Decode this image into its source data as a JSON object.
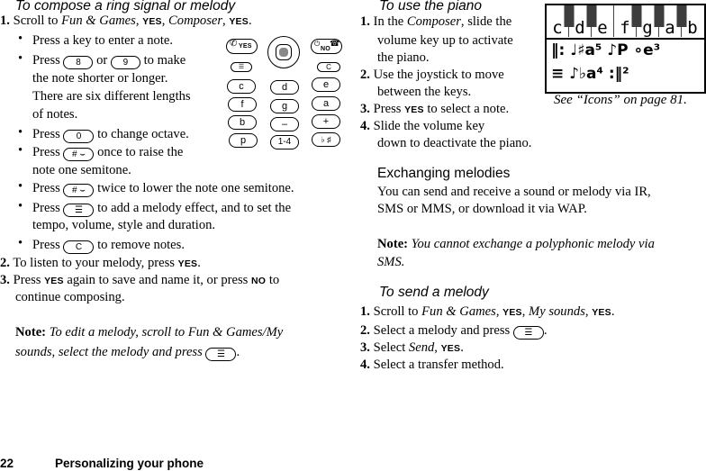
{
  "left": {
    "heading": "To compose a ring signal or melody",
    "step1": {
      "num": "1.",
      "pre": "Scroll to ",
      "fun_games": "Fun & Games",
      "sep1": ", ",
      "yes": "YES",
      "sep2": ", ",
      "composer": "Composer",
      "sep3": ", ",
      "yes2": "YES",
      "end": "."
    },
    "bullets": [
      {
        "text": "Press a key to enter a note."
      },
      {
        "pre": "Press",
        "key1": "8",
        "mid": "or",
        "key2": "9",
        "post": "to make",
        "l2": "the note shorter or longer.",
        "l3": "There are six different lengths",
        "l4": "of notes."
      },
      {
        "pre": "Press",
        "key": "0",
        "post": "to change octave."
      },
      {
        "pre": "Press",
        "key": "#",
        "post": "once to raise the",
        "l2": "note one semitone."
      },
      {
        "pre": "Press",
        "key": "#",
        "post": "twice to lower the note one semitone."
      },
      {
        "pre": "Press",
        "key_icon": "menu",
        "post": "to add a melody effect, and to set the",
        "l2": "tempo, volume, style and duration."
      },
      {
        "pre": "Press",
        "key": "C",
        "post": "to remove notes."
      }
    ],
    "step2": {
      "num": "2.",
      "pre": "To listen to your melody, press ",
      "yes": "YES",
      "end": "."
    },
    "step3": {
      "num": "3.",
      "pre": "Press ",
      "yes": "YES",
      "mid": " again to save and name it, or press ",
      "no": "NO",
      "post": " to",
      "l2": "continue composing."
    },
    "note": {
      "label": "Note:",
      "text1": " To edit a melody, scroll to Fun & Games/My",
      "text2": "sounds, select the melody and press",
      "end": "."
    }
  },
  "keypad": {
    "yes": "YES",
    "no": "NO",
    "c": "C",
    "row1": [
      "c",
      "d",
      "e"
    ],
    "row2": [
      "f",
      "g",
      "a"
    ],
    "row3": [
      "b",
      "–",
      "+"
    ],
    "row4": [
      "p",
      "1-4",
      "♭ ♯"
    ]
  },
  "right": {
    "heading": "To use the piano",
    "steps": [
      {
        "num": "1.",
        "pre": "In the ",
        "em": "Composer",
        "post": ", slide the",
        "l2": "volume key up to activate",
        "l3": "the piano."
      },
      {
        "num": "2.",
        "text": "Use the joystick to move",
        "l2": "between the keys."
      },
      {
        "num": "3.",
        "pre": "Press ",
        "yes": "YES",
        "post": " to select a note."
      },
      {
        "num": "4.",
        "text": "Slide the volume key",
        "l2": "down to deactivate the piano."
      }
    ],
    "screen": {
      "white_keys": [
        "c",
        "d",
        "e",
        "f",
        "g",
        "a",
        "b"
      ],
      "row1": "‖: ♩♯a⁵  ♪P  ∘e³",
      "row2": "≡  ♪♭a⁴  :‖²"
    },
    "caption": "See “Icons” on page 81.",
    "exchanging": {
      "title": "Exchanging melodies",
      "l1": "You can send and receive a sound or melody via IR,",
      "l2": "SMS or MMS, or download it via WAP."
    },
    "note": {
      "label": "Note:",
      "l1": " You cannot exchange a polyphonic melody via",
      "l2": "SMS."
    },
    "send_heading": "To send a melody",
    "send_steps": [
      {
        "num": "1.",
        "pre": "Scroll to ",
        "em1": "Fun & Games",
        "s1": ", ",
        "yes1": "YES",
        "s2": ", ",
        "em2": "My sounds",
        "s3": ", ",
        "yes2": "YES",
        "end": "."
      },
      {
        "num": "2.",
        "pre": "Select a melody and press",
        "end": "."
      },
      {
        "num": "3.",
        "pre": "Select ",
        "em": "Send",
        "s": ", ",
        "yes": "YES",
        "end": "."
      },
      {
        "num": "4.",
        "text": "Select a transfer method."
      }
    ]
  },
  "footer": {
    "page": "22",
    "title": "Personalizing your phone"
  }
}
